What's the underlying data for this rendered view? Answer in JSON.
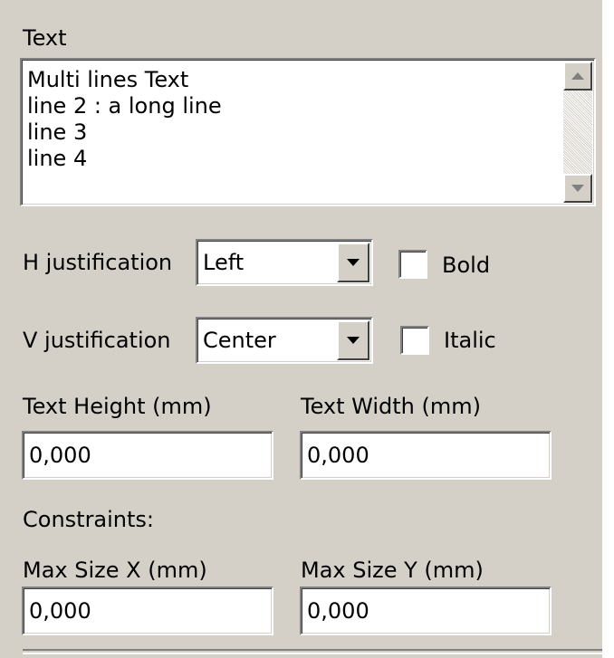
{
  "text_section": {
    "label": "Text",
    "lines": [
      "Multi lines Text",
      "line 2 : a long line",
      "line 3",
      "line 4"
    ]
  },
  "h_justification": {
    "label": "H justification",
    "value": "Left"
  },
  "v_justification": {
    "label": "V justification",
    "value": "Center"
  },
  "bold": {
    "label": "Bold",
    "checked": false
  },
  "italic": {
    "label": "Italic",
    "checked": false
  },
  "text_height": {
    "label": "Text Height (mm)",
    "value": "0,000"
  },
  "text_width": {
    "label": "Text Width (mm)",
    "value": "0,000"
  },
  "constraints": {
    "label": "Constraints:"
  },
  "max_size_x": {
    "label": "Max Size X (mm)",
    "value": "0,000"
  },
  "max_size_y": {
    "label": "Max Size Y (mm)",
    "value": "0,000"
  },
  "colors": {
    "panel_bg": "#d4d0c8",
    "field_bg": "#ffffff",
    "text": "#000000"
  },
  "icons": {
    "scroll_up": "triangle-up-icon",
    "scroll_down": "triangle-down-icon",
    "dropdown": "chevron-down-icon"
  }
}
